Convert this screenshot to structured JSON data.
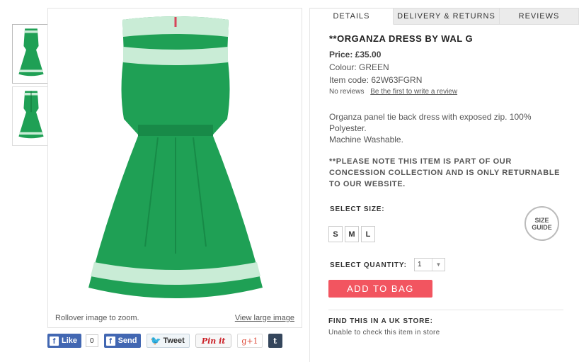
{
  "gallery": {
    "zoom_hint": "Rollover image to zoom.",
    "view_large": "View large image"
  },
  "social": {
    "like": "Like",
    "like_count": "0",
    "send": "Send",
    "tweet": "Tweet",
    "pinit": "Pin it",
    "gplus": "g+1",
    "tumblr": "t"
  },
  "tabs": [
    {
      "label": "DETAILS",
      "active": true
    },
    {
      "label": "DELIVERY & RETURNS",
      "active": false
    },
    {
      "label": "REVIEWS",
      "active": false
    }
  ],
  "product": {
    "title": "**ORGANZA DRESS BY WAL G",
    "price": "Price: £35.00",
    "colour": "Colour: GREEN",
    "item_code": "Item code: 62W63FGRN",
    "no_reviews": "No reviews",
    "write_review": "Be the first to write a review",
    "description_1": "Organza panel tie back dress with exposed zip. 100% Polyester.",
    "description_2": "Machine Washable.",
    "notice": "**PLEASE NOTE THIS ITEM IS PART OF OUR CONCESSION COLLECTION AND IS ONLY RETURNABLE TO OUR WEBSITE."
  },
  "size": {
    "label": "SELECT SIZE:",
    "options": [
      "S",
      "M",
      "L"
    ],
    "guide_line1": "SIZE",
    "guide_line2": "GUIDE"
  },
  "quantity": {
    "label": "SELECT QUANTITY:",
    "value": "1"
  },
  "add_to_bag": "ADD TO BAG",
  "store": {
    "title": "FIND THIS IN A UK STORE:",
    "message": "Unable to check this item in store"
  },
  "colors": {
    "dress_green": "#1fa055",
    "sheer_panel": "#c9ecd6",
    "add_button": "#f25560",
    "facebook": "#4267b2"
  }
}
